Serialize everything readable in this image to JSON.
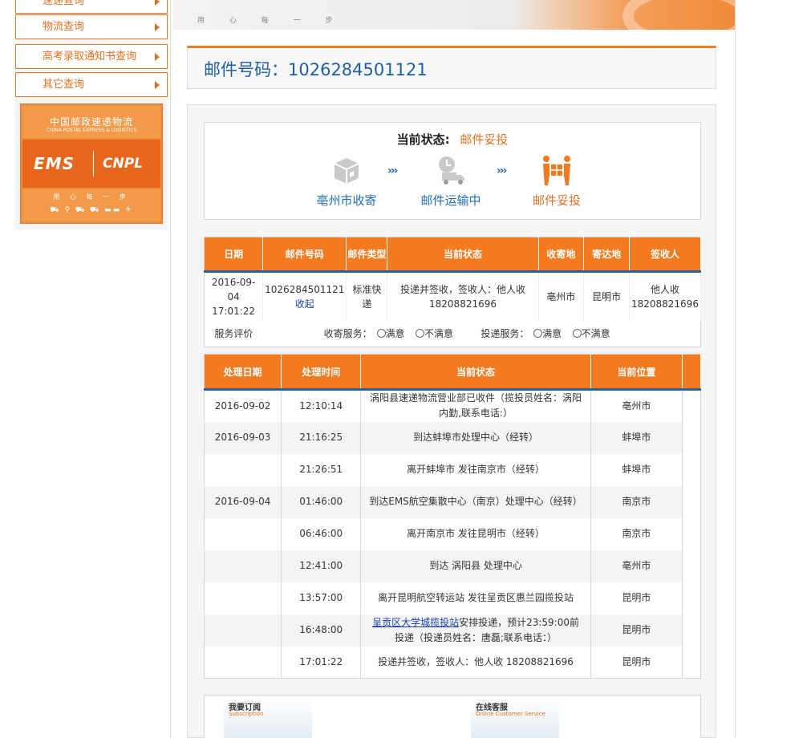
{
  "sidebar": {
    "items": [
      {
        "label": "速递查询"
      },
      {
        "label": "物流查询"
      },
      {
        "label": "高考录取通知书查询"
      },
      {
        "label": "其它查询"
      }
    ],
    "banner": {
      "cn_name": "中国邮政速递物流",
      "en_name": "CHINA POSTAL EXPRESS & LOGISTICS",
      "ems": "EMS",
      "cnpl": "CNPL",
      "slogan": "用 心 每 一 步"
    }
  },
  "top_banner": {
    "slogan": "用 心 每 一 步"
  },
  "mail_title": "邮件号码：1026284501121",
  "status": {
    "label": "当前状态:",
    "value": "邮件妥投",
    "steps": [
      {
        "label": "亳州市收寄",
        "icon": "package-box-icon",
        "state": "done"
      },
      {
        "label": "邮件运输中",
        "icon": "delivery-truck-icon",
        "state": "done"
      },
      {
        "label": "邮件妥投",
        "icon": "handover-people-icon",
        "state": "active"
      }
    ]
  },
  "summary": {
    "headers": [
      "日期",
      "邮件号码",
      "邮件类型",
      "当前状态",
      "收寄地",
      "寄达地",
      "签收人"
    ],
    "row": {
      "date": "2016-09-04 17:01:22",
      "mail_no": "1026284501121",
      "collapse_link": "收起",
      "type": "标准快递",
      "state": "投递并签收，签收人：他人收 18208821696",
      "origin": "亳州市",
      "destination": "昆明市",
      "signer": "他人收 18208821696"
    },
    "evaluation": {
      "label": "服务评价",
      "collect_label": "收寄服务：",
      "deliver_label": "投递服务：",
      "satisfied": "满意",
      "unsatisfied": "不满意"
    }
  },
  "tracking": {
    "headers": [
      "处理日期",
      "处理时间",
      "当前状态",
      "当前位置"
    ],
    "rows": [
      {
        "date": "2016-09-02",
        "time": "12:10:14",
        "status": "涡阳县速递物流营业部已收件（揽投员姓名：涡阳内勤,联系电话:）",
        "location": "亳州市"
      },
      {
        "date": "2016-09-03",
        "time": "21:16:25",
        "status": "到达蚌埠市处理中心（经转）",
        "location": "蚌埠市"
      },
      {
        "date": "",
        "time": "21:26:51",
        "status": "离开蚌埠市 发往南京市（经转）",
        "location": "蚌埠市"
      },
      {
        "date": "2016-09-04",
        "time": "01:46:00",
        "status": "到达EMS航空集散中心（南京）处理中心（经转）",
        "location": "南京市"
      },
      {
        "date": "",
        "time": "06:46:00",
        "status": "离开南京市 发往昆明市（经转）",
        "location": "南京市"
      },
      {
        "date": "",
        "time": "12:41:00",
        "status": "到达 涡阳县 处理中心",
        "location": "亳州市"
      },
      {
        "date": "",
        "time": "13:57:00",
        "status": "离开昆明航空转运站 发往呈贡区惠兰园揽投站",
        "location": "昆明市"
      },
      {
        "date": "",
        "time": "16:48:00",
        "status_link": "呈贡区大学城揽投站",
        "status": "安排投递，预计23:59:00前投递（投递员姓名：唐磊;联系电话：）",
        "location": "昆明市"
      },
      {
        "date": "",
        "time": "17:01:22",
        "status": "投递并签收，签收人：他人收 18208821696",
        "location": "昆明市"
      }
    ]
  },
  "bottom_cards": [
    {
      "title": "我要订阅",
      "subtitle": "Subscription"
    },
    {
      "title": "在线客服",
      "subtitle": "Online Customer Service"
    }
  ],
  "colors": {
    "accent": "#f47a20",
    "link": "#1f5fa8",
    "header_underline": "#2f5f9e"
  }
}
